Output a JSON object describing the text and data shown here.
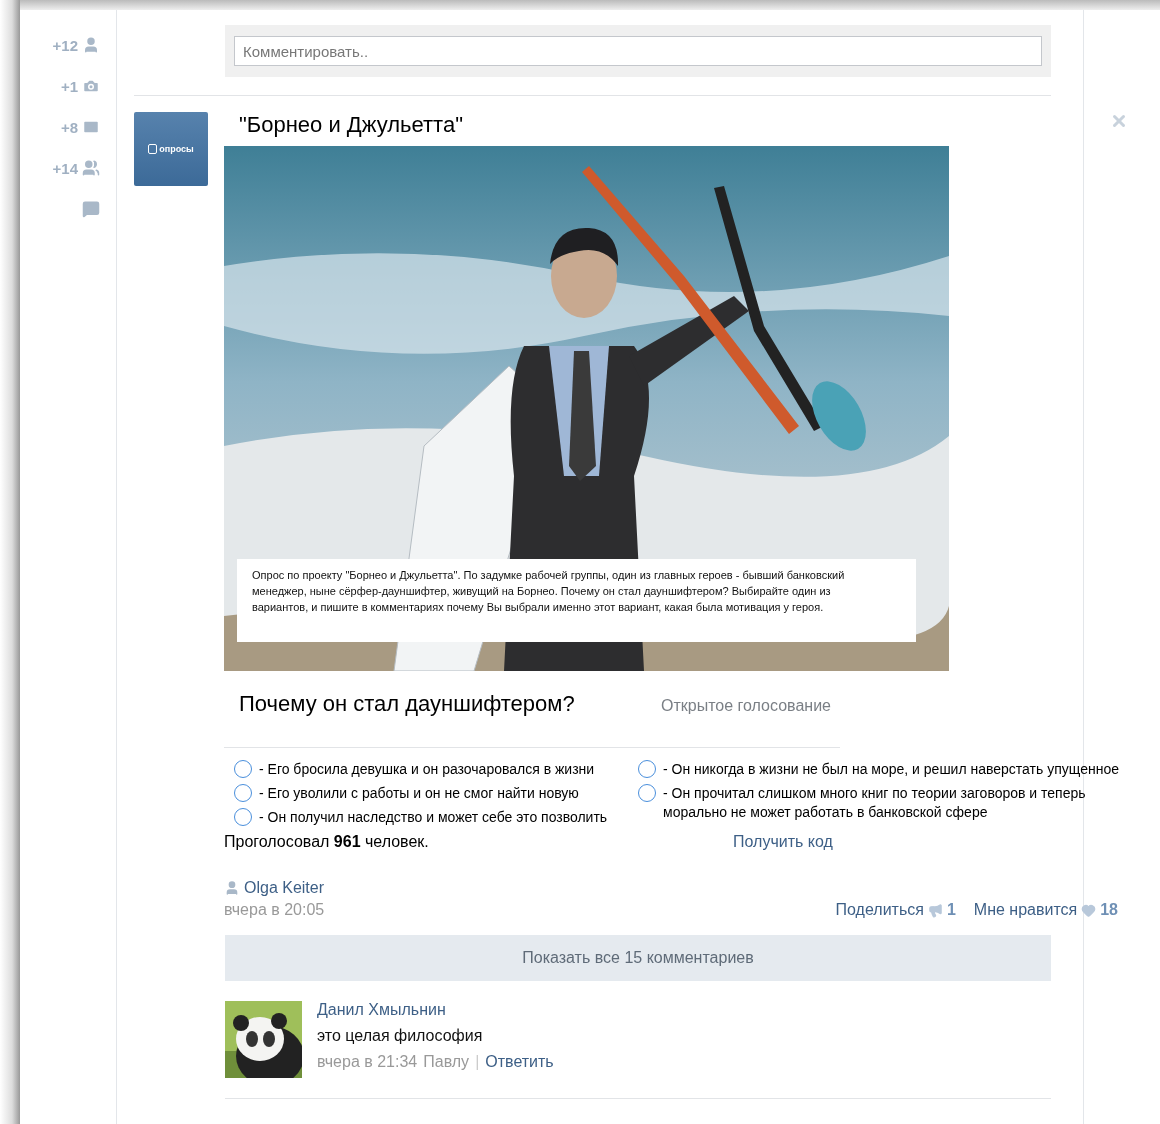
{
  "counters": [
    {
      "kind": "user",
      "count": "+12"
    },
    {
      "kind": "camera",
      "count": "+1"
    },
    {
      "kind": "mail",
      "count": "+8"
    },
    {
      "kind": "users",
      "count": "+14"
    },
    {
      "kind": "chat"
    }
  ],
  "comment_field": {
    "placeholder": "Комментировать.."
  },
  "post": {
    "avatar_label": "опросы",
    "title": "\"Борнео и Джульетта\"",
    "photo": {
      "kind": "picture"
    },
    "description": "Опрос по проекту \"Борнео и Джульетта\". По задумке рабочей группы, один из главных героев - бывший банковский менеджер, ныне сёрфер-дауншифтер, живущий на Борнео. Почему он стал дауншифтером? Выбирайте один из вариантов, и пишите в комментариях почему Вы выбрали именно этот вариант, какая была мотивация у героя.",
    "question": "Почему он стал дауншифтером?",
    "poll_type": "Открытое голосование",
    "options": [
      [
        {
          "text": "- Его бросила девушка и он разочаровался в жизни",
          "selected": false
        },
        {
          "text": "- Его уволили с работы и он не смог найти новую",
          "selected": false
        },
        {
          "text": "- Он получил наследство и может себе это позволить",
          "selected": false
        }
      ],
      [
        {
          "text": "- Он никогда в жизни не был на море, и решил наверстать упущенное",
          "selected": false
        },
        {
          "text": "- Он прочитал слишком много книг по теории заговоров и теперь морально не может работать в банковской сфере",
          "selected": false
        }
      ]
    ],
    "votes": "Проголосовал **961** человек.",
    "get_code": "Получить код",
    "author": "Olga Keiter",
    "time": "вчера в 20:05",
    "share_label": "Поделиться",
    "share_count": "1",
    "like_label": "Мне нравится",
    "like_count": "18"
  },
  "show_all_comments": "Показать все 15 комментариев",
  "comments": [
    {
      "author": "Данил Хмыльнин",
      "text": "это целая философия",
      "time": "вчера в 21:34",
      "reply_to": "Павлу",
      "separator": "|",
      "reply_label": "Ответить"
    }
  ]
}
